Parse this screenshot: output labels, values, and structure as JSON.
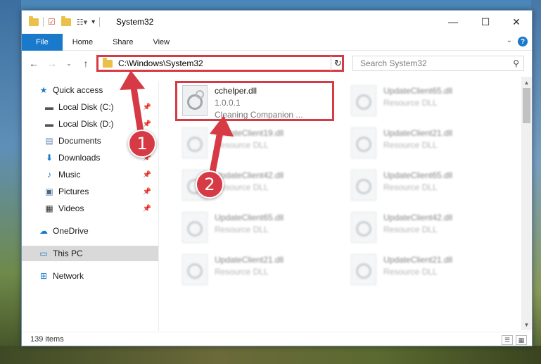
{
  "window": {
    "title": "System32",
    "controls": {
      "minimize": "—",
      "maximize": "☐",
      "close": "✕"
    }
  },
  "ribbon": {
    "tabs": [
      "File",
      "Home",
      "Share",
      "View"
    ],
    "help": "?"
  },
  "nav": {
    "address": "C:\\Windows\\System32",
    "search_placeholder": "Search System32"
  },
  "sidebar": {
    "items": [
      {
        "label": "Quick access",
        "icon": "star-icon"
      },
      {
        "label": "Local Disk (C:)",
        "icon": "drive-icon",
        "pinned": true
      },
      {
        "label": "Local Disk (D:)",
        "icon": "drive-icon",
        "pinned": true
      },
      {
        "label": "Documents",
        "icon": "documents-icon",
        "pinned": true
      },
      {
        "label": "Downloads",
        "icon": "download-icon",
        "pinned": true
      },
      {
        "label": "Music",
        "icon": "music-icon",
        "pinned": true
      },
      {
        "label": "Pictures",
        "icon": "pictures-icon",
        "pinned": true
      },
      {
        "label": "Videos",
        "icon": "videos-icon",
        "pinned": true
      },
      {
        "label": "OneDrive",
        "icon": "cloud-icon"
      },
      {
        "label": "This PC",
        "icon": "computer-icon",
        "selected": true
      },
      {
        "label": "Network",
        "icon": "network-icon"
      }
    ]
  },
  "files": {
    "highlighted": {
      "name": "cchelper.dll",
      "version": "1.0.0.1",
      "description": "Cleaning Companion ..."
    },
    "others": [
      {
        "name": "UpdateClient65.dll",
        "type": "Resource DLL"
      },
      {
        "name": "UpdateClient19.dll",
        "type": "Resource DLL"
      },
      {
        "name": "UpdateClient21.dll",
        "type": "Resource DLL"
      },
      {
        "name": "UpdateClient42.dll",
        "type": "Resource DLL"
      },
      {
        "name": "UpdateClient65.dll",
        "type": "Resource DLL"
      },
      {
        "name": "UpdateClient65.dll",
        "type": "Resource DLL"
      },
      {
        "name": "UpdateClient42.dll",
        "type": "Resource DLL"
      },
      {
        "name": "UpdateClient21.dll",
        "type": "Resource DLL"
      },
      {
        "name": "UpdateClient21.dll",
        "type": "Resource DLL"
      }
    ]
  },
  "status": {
    "item_count": "139 items"
  },
  "annotations": {
    "marker1": "1",
    "marker2": "2",
    "color": "#d63a45"
  }
}
